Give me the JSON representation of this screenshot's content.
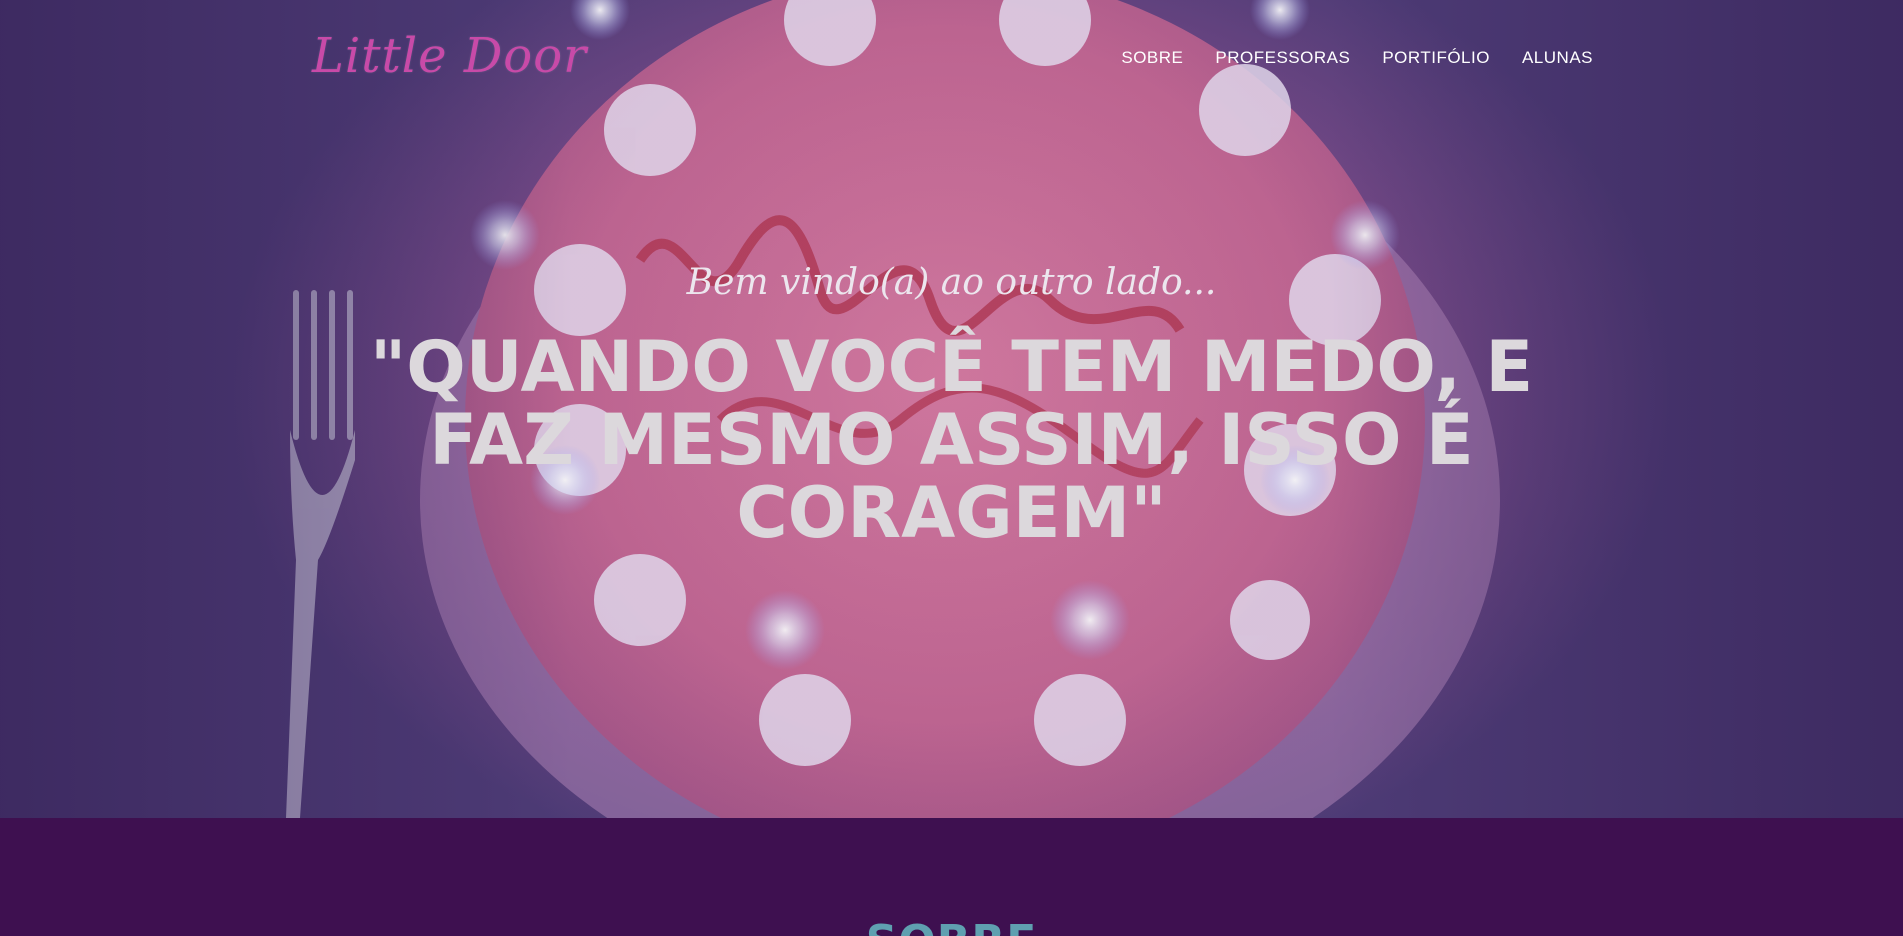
{
  "brand": {
    "logo_text": "Little Door",
    "logo_color": "#c84aa8"
  },
  "nav": {
    "items": [
      {
        "label": "SOBRE"
      },
      {
        "label": "PROFESSORAS"
      },
      {
        "label": "PORTIFÓLIO"
      },
      {
        "label": "ALUNAS"
      }
    ]
  },
  "hero": {
    "subtitle": "Bem vindo(a) ao outro lado...",
    "headline": "\"QUANDO VOCÊ TEM MEDO, E FAZ MESMO ASSIM, ISSO É CORAGEM\"",
    "background_image": "birthday-cake-with-candles"
  },
  "sobre": {
    "title": "SOBRE"
  },
  "colors": {
    "section_bg": "#3e1050",
    "section_title": "#5fa0b0",
    "headline_text": "#dcd8dc"
  }
}
